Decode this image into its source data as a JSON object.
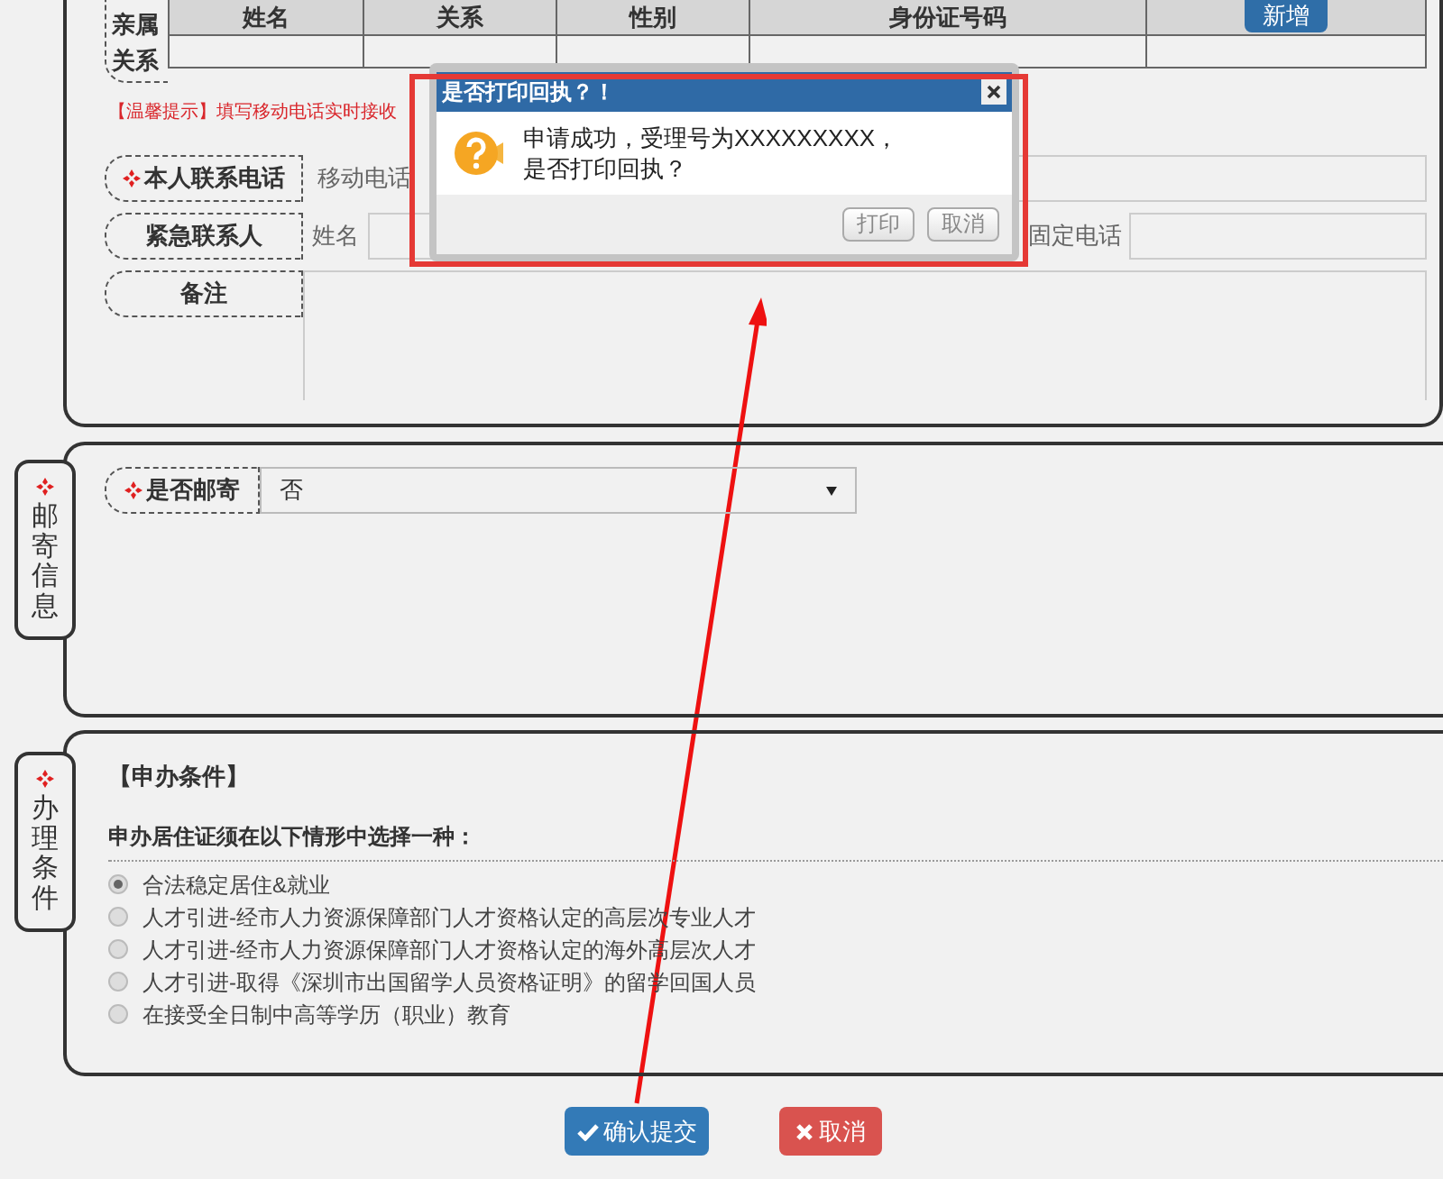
{
  "relatives": {
    "label": "亲属关系",
    "columns": [
      "姓名",
      "关系",
      "性别",
      "身份证号码"
    ],
    "add_button": "新增"
  },
  "hint": "【温馨提示】填写移动电话实时接收",
  "contact_fields": [
    {
      "kind": "phone",
      "label": "本人联系电话",
      "required": true,
      "field_label": "移动电话"
    },
    {
      "kind": "contact",
      "label": "紧急联系人",
      "name_label": "姓名",
      "phone_label": "固定电话"
    },
    {
      "kind": "textarea",
      "label": "备注"
    }
  ],
  "mailing": {
    "tab": "邮寄信息",
    "field": {
      "label": "是否邮寄",
      "required": true,
      "value": "否"
    }
  },
  "conditions": {
    "tab": "办理条件",
    "title": "【申办条件】",
    "prompt": "申办居住证须在以下情形中选择一种：",
    "options": [
      {
        "label": "合法稳定居住&就业",
        "selected": true
      },
      {
        "label": "人才引进-经市人力资源保障部门人才资格认定的高层次专业人才",
        "selected": false
      },
      {
        "label": "人才引进-经市人力资源保障部门人才资格认定的海外高层次人才",
        "selected": false
      },
      {
        "label": "人才引进-取得《深圳市出国留学人员资格证明》的留学回国人员",
        "selected": false
      },
      {
        "label": "在接受全日制中高等学历（职业）教育",
        "selected": false
      }
    ]
  },
  "buttons": [
    {
      "kind": "confirm",
      "label": "确认提交"
    },
    {
      "kind": "cancel",
      "label": "取消"
    }
  ],
  "dialog": {
    "title": "是否打印回执？！",
    "message_lines": [
      "申请成功，受理号为XXXXXXXXX，",
      "是否打印回执？"
    ],
    "buttons": [
      "打印",
      "取消"
    ]
  }
}
